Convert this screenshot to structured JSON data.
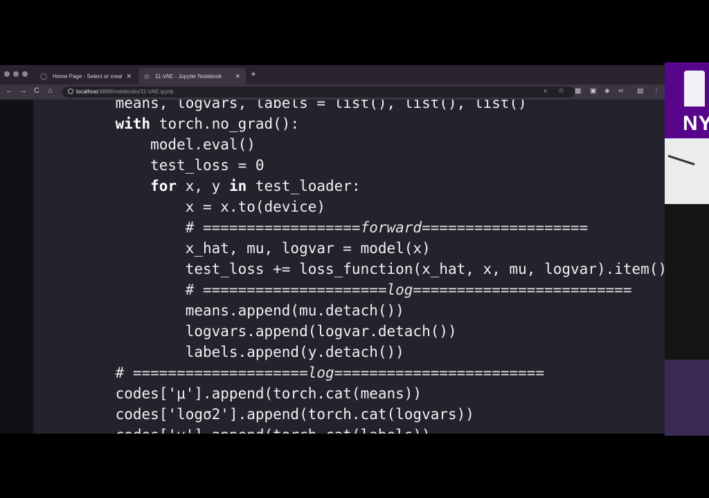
{
  "browser": {
    "tabs": [
      {
        "title": "Home Page - Select or create a",
        "icon": "circle-icon",
        "active": false
      },
      {
        "title": "11-VAE - Jupyter Notebook",
        "icon": "jupyter-icon",
        "active": true
      }
    ],
    "new_tab_label": "+",
    "address": {
      "host": "localhost",
      "path": ":8888/notebooks/11-VAE.ipynb"
    },
    "nav": {
      "back": "←",
      "forward": "→",
      "reload": "C",
      "home": "⌂"
    }
  },
  "notebook": {
    "code_lines": [
      [
        {
          "t": "    means, logvars, labels = list(), list(), list()",
          "c": ""
        }
      ],
      [
        {
          "t": "    ",
          "c": ""
        },
        {
          "t": "with",
          "c": "kw"
        },
        {
          "t": " torch.no_grad():",
          "c": ""
        }
      ],
      [
        {
          "t": "        model.eval()",
          "c": ""
        }
      ],
      [
        {
          "t": "        test_loss = 0",
          "c": ""
        }
      ],
      [
        {
          "t": "        ",
          "c": ""
        },
        {
          "t": "for",
          "c": "kw"
        },
        {
          "t": " x, y ",
          "c": ""
        },
        {
          "t": "in",
          "c": "kw"
        },
        {
          "t": " test_loader:",
          "c": ""
        }
      ],
      [
        {
          "t": "            x = x.to(device)",
          "c": ""
        }
      ],
      [
        {
          "t": "            # ==================forward===================",
          "c": "cm"
        }
      ],
      [
        {
          "t": "            x_hat, mu, logvar = model(x)",
          "c": ""
        }
      ],
      [
        {
          "t": "            test_loss += loss_function(x_hat, x, mu, logvar).item()",
          "c": ""
        }
      ],
      [
        {
          "t": "            # =====================log=========================",
          "c": "cm"
        }
      ],
      [
        {
          "t": "            means.append(mu.detach())",
          "c": ""
        }
      ],
      [
        {
          "t": "            logvars.append(logvar.detach())",
          "c": ""
        }
      ],
      [
        {
          "t": "            labels.append(y.detach())",
          "c": ""
        }
      ],
      [
        {
          "t": "    # ====================log========================",
          "c": "cm"
        }
      ],
      [
        {
          "t": "    codes['μ'].append(torch.cat(means))",
          "c": ""
        }
      ],
      [
        {
          "t": "    codes['logσ2'].append(torch.cat(logvars))",
          "c": ""
        }
      ],
      [
        {
          "t": "    codes['y'].append(torch.cat(labels))",
          "c": ""
        }
      ]
    ]
  },
  "sidebar": {
    "logo_text": "NYU"
  }
}
